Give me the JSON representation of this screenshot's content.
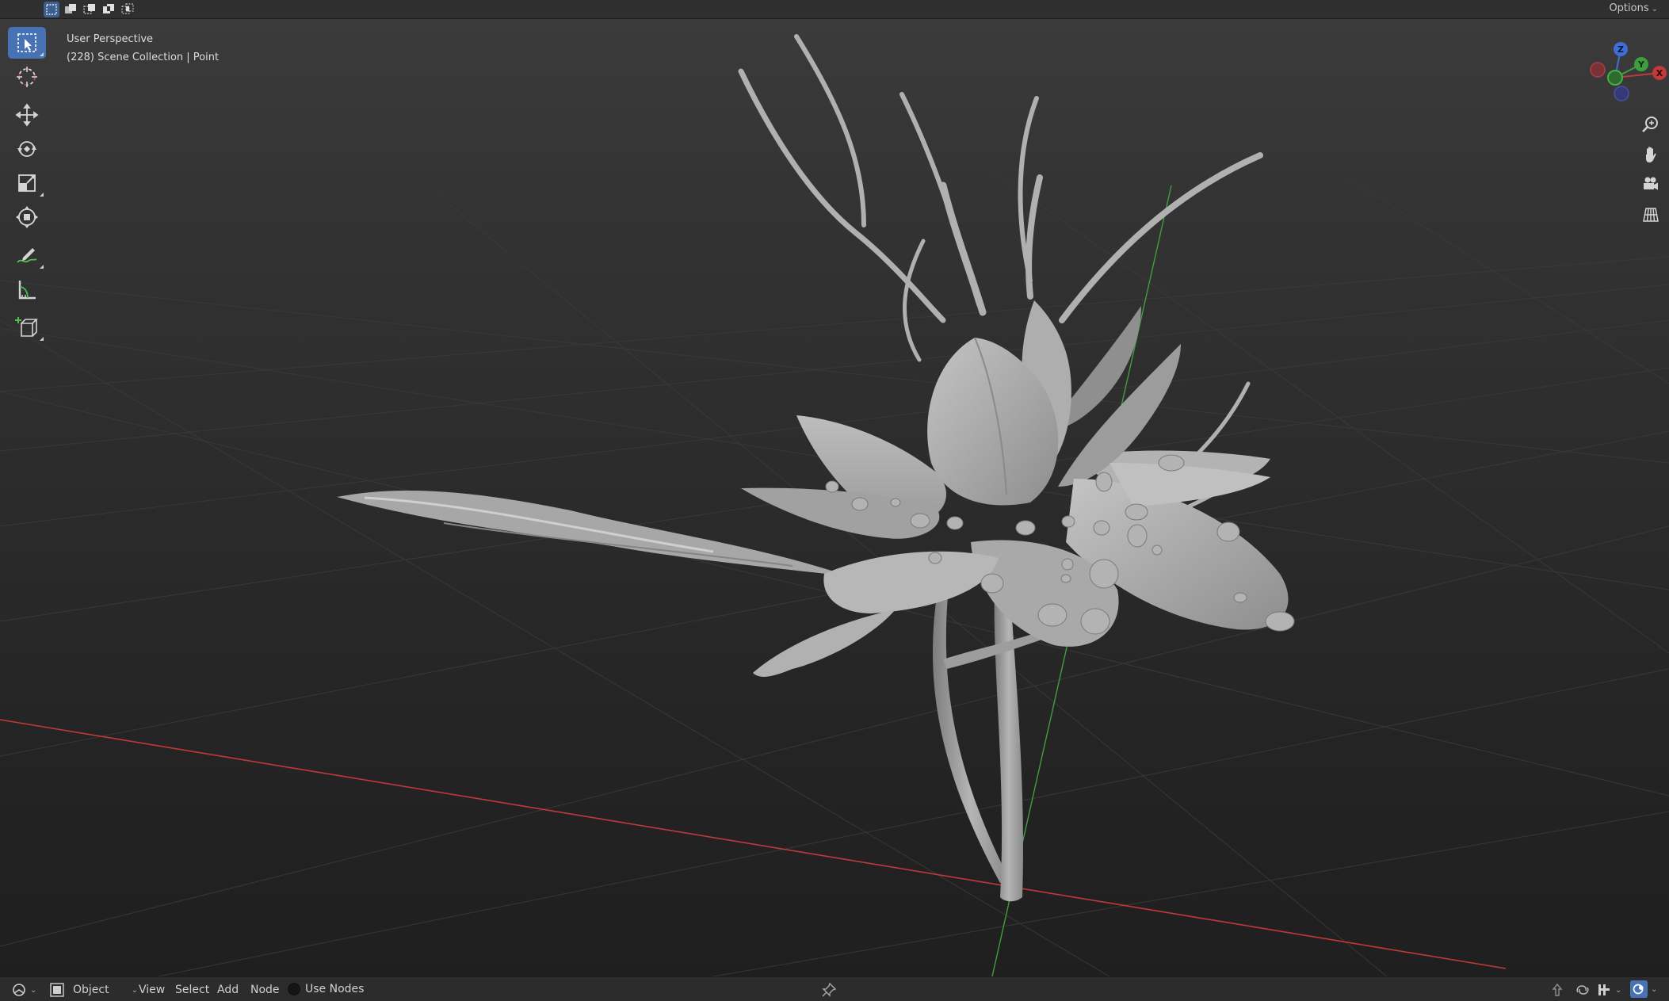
{
  "top_bar": {
    "selection_modes": [
      {
        "name": "mode-new",
        "icon": "select-new-icon",
        "active": true
      },
      {
        "name": "mode-extend",
        "icon": "select-extend-icon",
        "active": false
      },
      {
        "name": "mode-subtract",
        "icon": "select-subtract-icon",
        "active": false
      },
      {
        "name": "mode-difference",
        "icon": "select-difference-icon",
        "active": false
      },
      {
        "name": "mode-intersect",
        "icon": "select-intersect-icon",
        "active": false
      }
    ],
    "options_label": "Options"
  },
  "viewport": {
    "view_name": "User Perspective",
    "collection_info": "(228) Scene Collection | Point",
    "colors": {
      "x_axis": "#c0393b",
      "y_axis": "#3f9e3f",
      "z_axis": "#3f6fd6",
      "mesh": "#a6a6a6",
      "active_tool": "#4772b3"
    }
  },
  "toolbar": {
    "tools": [
      {
        "name": "select-box",
        "icon": "select-box-icon",
        "active": true
      },
      {
        "name": "cursor",
        "icon": "cursor-icon",
        "active": false
      },
      {
        "name": "move",
        "icon": "move-icon",
        "active": false
      },
      {
        "name": "rotate",
        "icon": "rotate-icon",
        "active": false
      },
      {
        "name": "scale",
        "icon": "scale-icon",
        "active": false
      },
      {
        "name": "transform",
        "icon": "transform-icon",
        "active": false
      },
      {
        "name": "annotate",
        "icon": "annotate-icon",
        "active": false
      },
      {
        "name": "measure",
        "icon": "measure-icon",
        "active": false
      },
      {
        "name": "add-cube",
        "icon": "add-cube-icon",
        "active": false
      }
    ]
  },
  "gizmo": {
    "x_label": "X",
    "y_label": "Y",
    "z_label": "Z"
  },
  "nav_controls": [
    {
      "name": "zoom",
      "icon": "zoom-icon"
    },
    {
      "name": "pan",
      "icon": "hand-icon"
    },
    {
      "name": "camera",
      "icon": "camera-icon"
    },
    {
      "name": "projection",
      "icon": "grid-icon"
    }
  ],
  "bottom_bar": {
    "mode_label": "Object",
    "menu": {
      "view": "View",
      "select": "Select",
      "add": "Add",
      "node": "Node"
    },
    "use_nodes_label": "Use Nodes"
  }
}
